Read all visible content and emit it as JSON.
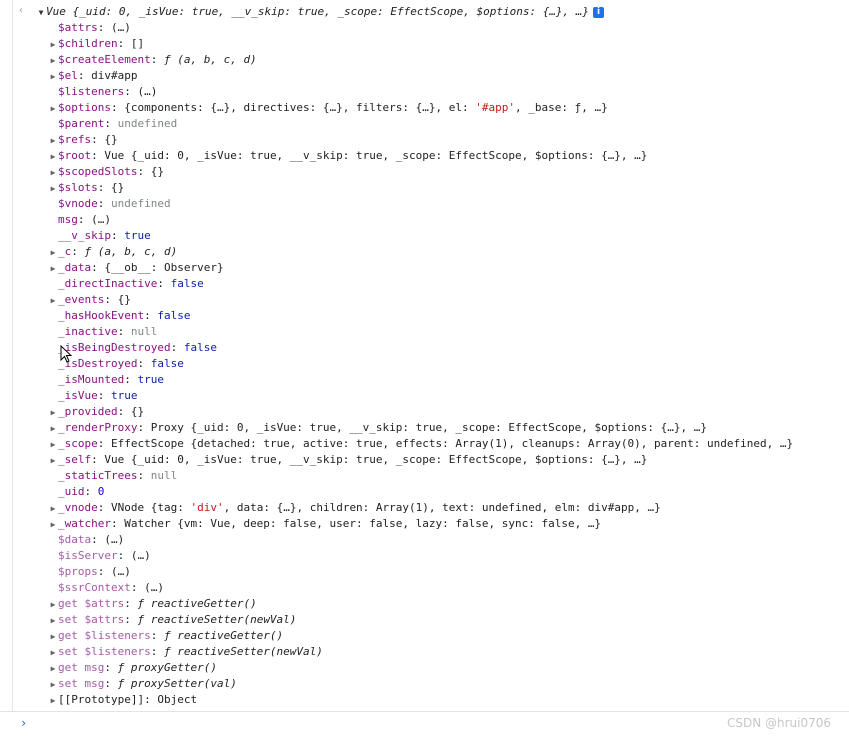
{
  "header": {
    "back_glyph": "‹",
    "object_text": "Vue {_uid: 0, _isVue: true, __v_skip: true, _scope: EffectScope, $options: {…}, …}"
  },
  "rows": [
    {
      "indent": 1,
      "arrow": false,
      "key": "$attrs",
      "dim": false,
      "value": "(…)"
    },
    {
      "indent": 1,
      "arrow": true,
      "key": "$children",
      "dim": false,
      "value": "[]"
    },
    {
      "indent": 1,
      "arrow": true,
      "key": "$createElement",
      "dim": false,
      "value": "ƒ (a, b, c, d)",
      "vclass": "fn"
    },
    {
      "indent": 1,
      "arrow": true,
      "key": "$el",
      "dim": false,
      "value": "div#app"
    },
    {
      "indent": 1,
      "arrow": false,
      "key": "$listeners",
      "dim": false,
      "value": "(…)"
    },
    {
      "indent": 1,
      "arrow": true,
      "key": "$options",
      "dim": false,
      "value": "{components: {…}, directives: {…}, filters: {…}, el: '#app', _base: ƒ, …}"
    },
    {
      "indent": 1,
      "arrow": false,
      "key": "$parent",
      "dim": false,
      "value": "undefined",
      "vclass": "undef"
    },
    {
      "indent": 1,
      "arrow": true,
      "key": "$refs",
      "dim": false,
      "value": "{}"
    },
    {
      "indent": 1,
      "arrow": true,
      "key": "$root",
      "dim": false,
      "value": "Vue {_uid: 0, _isVue: true, __v_skip: true, _scope: EffectScope, $options: {…}, …}"
    },
    {
      "indent": 1,
      "arrow": true,
      "key": "$scopedSlots",
      "dim": false,
      "value": "{}"
    },
    {
      "indent": 1,
      "arrow": true,
      "key": "$slots",
      "dim": false,
      "value": "{}"
    },
    {
      "indent": 1,
      "arrow": false,
      "key": "$vnode",
      "dim": false,
      "value": "undefined",
      "vclass": "undef"
    },
    {
      "indent": 1,
      "arrow": false,
      "key": "msg",
      "dim": false,
      "value": "(…)"
    },
    {
      "indent": 1,
      "arrow": false,
      "key": "__v_skip",
      "dim": false,
      "value": "true",
      "vclass": "kw"
    },
    {
      "indent": 1,
      "arrow": true,
      "key": "_c",
      "dim": false,
      "value": "ƒ (a, b, c, d)",
      "vclass": "fn"
    },
    {
      "indent": 1,
      "arrow": true,
      "key": "_data",
      "dim": false,
      "value": "{__ob__: Observer}"
    },
    {
      "indent": 1,
      "arrow": false,
      "key": "_directInactive",
      "dim": false,
      "value": "false",
      "vclass": "kw"
    },
    {
      "indent": 1,
      "arrow": true,
      "key": "_events",
      "dim": false,
      "value": "{}"
    },
    {
      "indent": 1,
      "arrow": false,
      "key": "_hasHookEvent",
      "dim": false,
      "value": "false",
      "vclass": "kw"
    },
    {
      "indent": 1,
      "arrow": false,
      "key": "_inactive",
      "dim": false,
      "value": "null",
      "vclass": "undef"
    },
    {
      "indent": 1,
      "arrow": false,
      "key": "_isBeingDestroyed",
      "dim": false,
      "value": "false",
      "vclass": "kw"
    },
    {
      "indent": 1,
      "arrow": false,
      "key": "_isDestroyed",
      "dim": false,
      "value": "false",
      "vclass": "kw"
    },
    {
      "indent": 1,
      "arrow": false,
      "key": "_isMounted",
      "dim": false,
      "value": "true",
      "vclass": "kw"
    },
    {
      "indent": 1,
      "arrow": false,
      "key": "_isVue",
      "dim": false,
      "value": "true",
      "vclass": "kw"
    },
    {
      "indent": 1,
      "arrow": true,
      "key": "_provided",
      "dim": false,
      "value": "{}"
    },
    {
      "indent": 1,
      "arrow": true,
      "key": "_renderProxy",
      "dim": false,
      "value": "Proxy {_uid: 0, _isVue: true, __v_skip: true, _scope: EffectScope, $options: {…}, …}"
    },
    {
      "indent": 1,
      "arrow": true,
      "key": "_scope",
      "dim": false,
      "value": "EffectScope {detached: true, active: true, effects: Array(1), cleanups: Array(0), parent: undefined, …}"
    },
    {
      "indent": 1,
      "arrow": true,
      "key": "_self",
      "dim": false,
      "value": "Vue {_uid: 0, _isVue: true, __v_skip: true, _scope: EffectScope, $options: {…}, …}"
    },
    {
      "indent": 1,
      "arrow": false,
      "key": "_staticTrees",
      "dim": false,
      "value": "null",
      "vclass": "undef"
    },
    {
      "indent": 1,
      "arrow": false,
      "key": "_uid",
      "dim": false,
      "value": "0",
      "vclass": "num"
    },
    {
      "indent": 1,
      "arrow": true,
      "key": "_vnode",
      "dim": false,
      "value": "VNode {tag: 'div', data: {…}, children: Array(1), text: undefined, elm: div#app, …}"
    },
    {
      "indent": 1,
      "arrow": true,
      "key": "_watcher",
      "dim": false,
      "value": "Watcher {vm: Vue, deep: false, user: false, lazy: false, sync: false, …}"
    },
    {
      "indent": 1,
      "arrow": false,
      "key": "$data",
      "dim": true,
      "value": "(…)"
    },
    {
      "indent": 1,
      "arrow": false,
      "key": "$isServer",
      "dim": true,
      "value": "(…)"
    },
    {
      "indent": 1,
      "arrow": false,
      "key": "$props",
      "dim": true,
      "value": "(…)"
    },
    {
      "indent": 1,
      "arrow": false,
      "key": "$ssrContext",
      "dim": true,
      "value": "(…)"
    },
    {
      "indent": 1,
      "arrow": true,
      "key": "get $attrs",
      "dim": true,
      "value": "ƒ reactiveGetter()",
      "vclass": "fn"
    },
    {
      "indent": 1,
      "arrow": true,
      "key": "set $attrs",
      "dim": true,
      "value": "ƒ reactiveSetter(newVal)",
      "vclass": "fn"
    },
    {
      "indent": 1,
      "arrow": true,
      "key": "get $listeners",
      "dim": true,
      "value": "ƒ reactiveGetter()",
      "vclass": "fn"
    },
    {
      "indent": 1,
      "arrow": true,
      "key": "set $listeners",
      "dim": true,
      "value": "ƒ reactiveSetter(newVal)",
      "vclass": "fn"
    },
    {
      "indent": 1,
      "arrow": true,
      "key": "get msg",
      "dim": true,
      "value": "ƒ proxyGetter()",
      "vclass": "fn"
    },
    {
      "indent": 1,
      "arrow": true,
      "key": "set msg",
      "dim": true,
      "value": "ƒ proxySetter(val)",
      "vclass": "fn"
    },
    {
      "indent": 1,
      "arrow": true,
      "key": "[[Prototype]]",
      "dim": false,
      "value": "Object",
      "plainkey": true
    }
  ],
  "prompt": {
    "glyph": "›"
  },
  "watermark": "CSDN @hrui0706",
  "colors": {
    "key": "#881280",
    "keyword": "#0d22aa",
    "string": "#c41a16",
    "accent": "#1a73e8"
  },
  "icons": {
    "info": "info-icon",
    "expand": "triangle-right-icon",
    "collapse": "triangle-down-icon"
  }
}
